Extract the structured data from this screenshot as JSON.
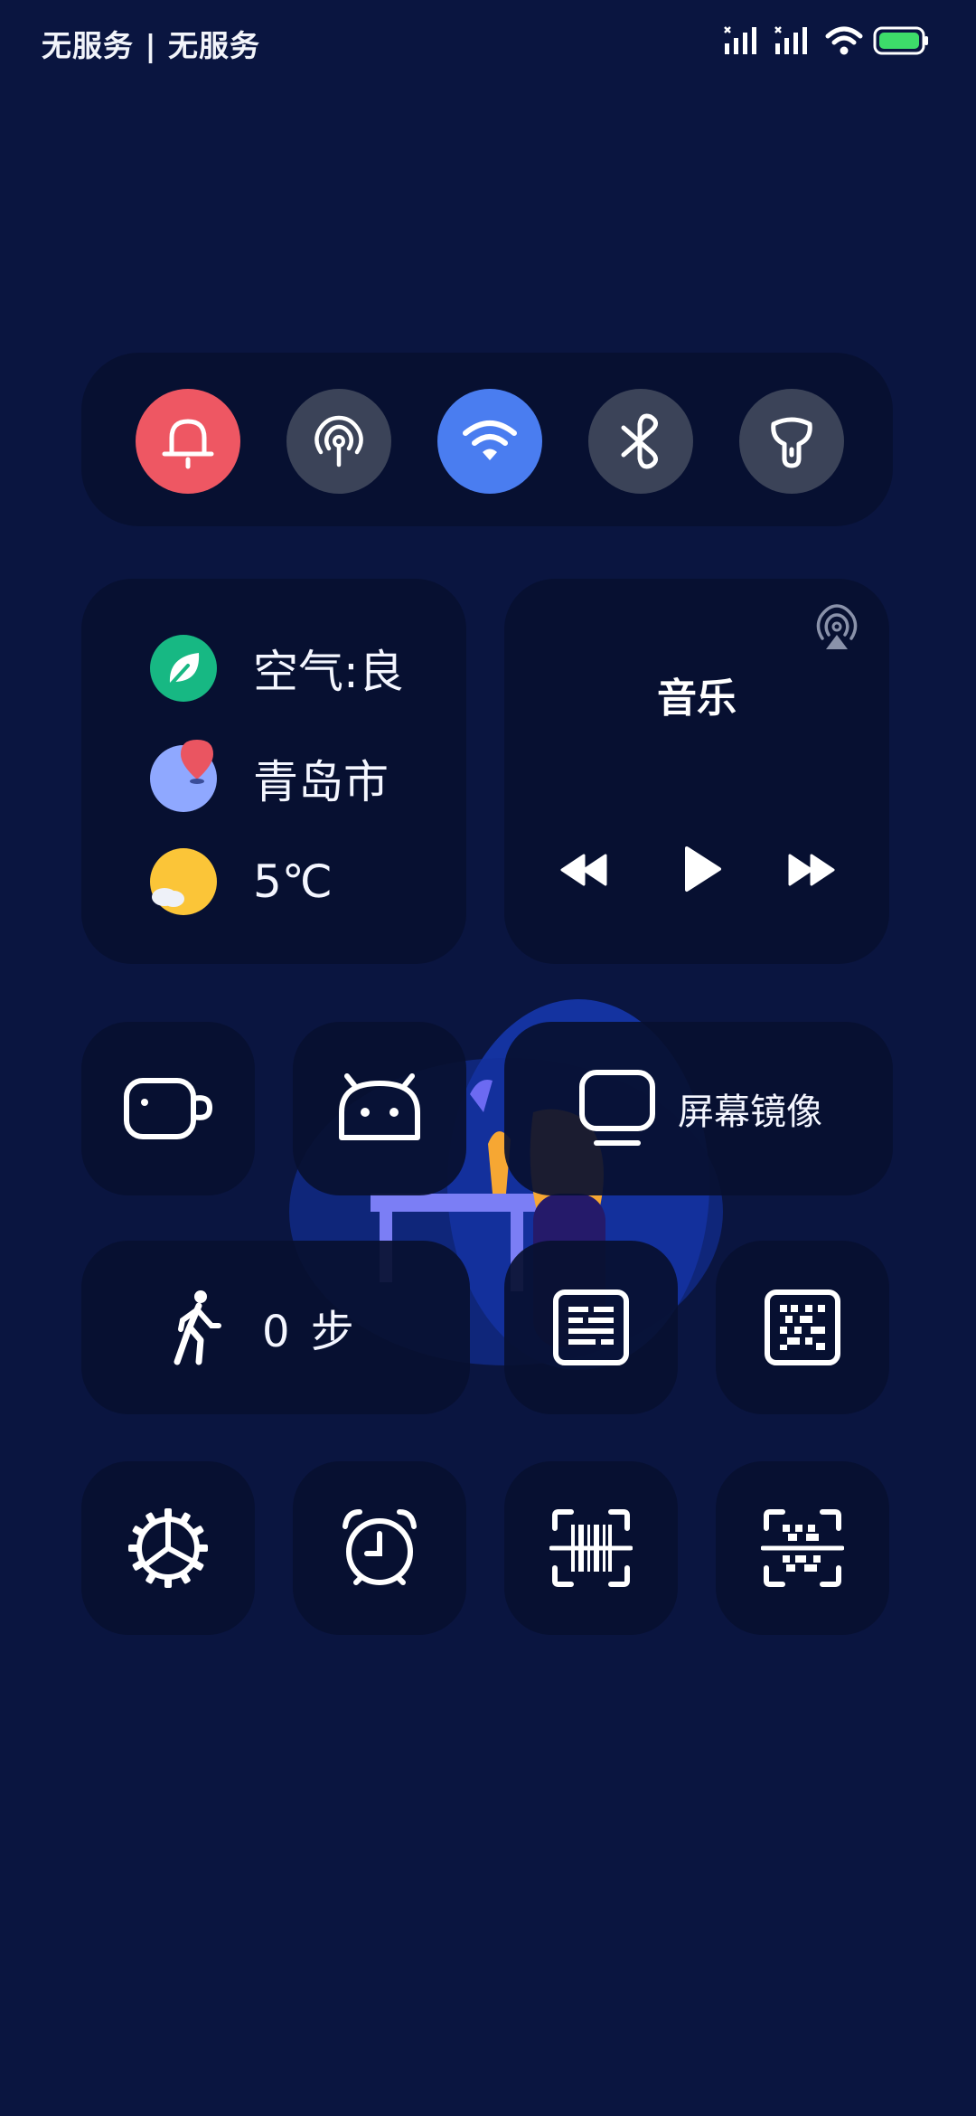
{
  "status_bar": {
    "carrier": "无服务 | 无服务",
    "icons": [
      "signal-1-icon",
      "signal-2-icon",
      "wifi-icon",
      "battery-icon"
    ],
    "battery_color": "#3ddc6a"
  },
  "toggles": [
    {
      "name": "bell-icon",
      "color": "#ee5763",
      "active": true
    },
    {
      "name": "hotspot-icon",
      "color": "#3b4358",
      "active": false
    },
    {
      "name": "wifi-icon",
      "color": "#4a7df0",
      "active": true
    },
    {
      "name": "bluetooth-icon",
      "color": "#3b4358",
      "active": false
    },
    {
      "name": "flashlight-icon",
      "color": "#3b4358",
      "active": false
    }
  ],
  "info": {
    "air_quality": "空气:良",
    "city": "青岛市",
    "temperature": "5℃"
  },
  "music": {
    "title": "音乐"
  },
  "tiles": {
    "screen_mirror_label": "屏幕镜像",
    "steps_label": "0 步"
  }
}
